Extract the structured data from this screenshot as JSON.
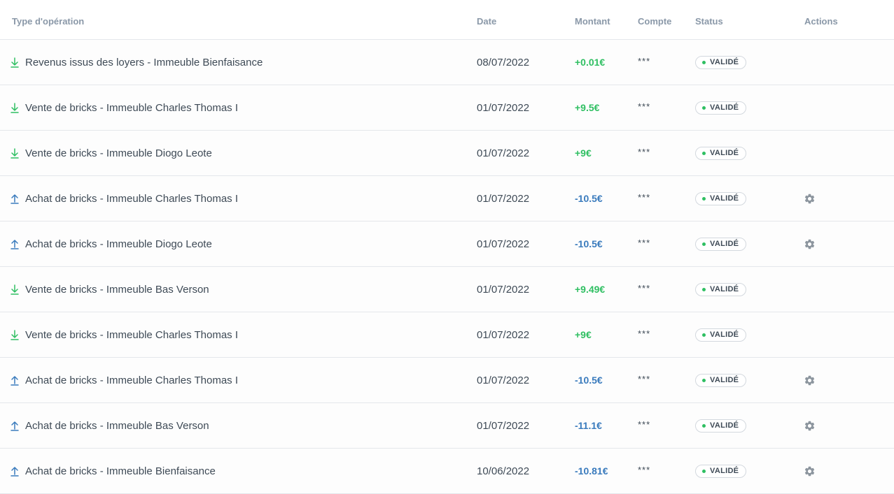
{
  "colors": {
    "positive": "#2fbf62",
    "negative": "#3a7bbd",
    "header_text": "#8a98a8",
    "border": "#e4e7eb"
  },
  "table": {
    "headers": {
      "type": "Type d'opération",
      "date": "Date",
      "amount": "Montant",
      "account": "Compte",
      "status": "Status",
      "actions": "Actions"
    },
    "rows": [
      {
        "direction": "in",
        "icon": "arrow-down-icon",
        "type": "Revenus issus des loyers - Immeuble Bienfaisance",
        "date": "08/07/2022",
        "amount": "+0.01€",
        "account": "***",
        "status": "VALIDÉ",
        "has_action": false
      },
      {
        "direction": "in",
        "icon": "arrow-down-icon",
        "type": "Vente de bricks - Immeuble Charles Thomas I",
        "date": "01/07/2022",
        "amount": "+9.5€",
        "account": "***",
        "status": "VALIDÉ",
        "has_action": false
      },
      {
        "direction": "in",
        "icon": "arrow-down-icon",
        "type": "Vente de bricks - Immeuble Diogo Leote",
        "date": "01/07/2022",
        "amount": "+9€",
        "account": "***",
        "status": "VALIDÉ",
        "has_action": false
      },
      {
        "direction": "out",
        "icon": "arrow-up-icon",
        "type": "Achat de bricks - Immeuble Charles Thomas I",
        "date": "01/07/2022",
        "amount": "-10.5€",
        "account": "***",
        "status": "VALIDÉ",
        "has_action": true,
        "action_icon": "gear-icon"
      },
      {
        "direction": "out",
        "icon": "arrow-up-icon",
        "type": "Achat de bricks - Immeuble Diogo Leote",
        "date": "01/07/2022",
        "amount": "-10.5€",
        "account": "***",
        "status": "VALIDÉ",
        "has_action": true,
        "action_icon": "gear-icon"
      },
      {
        "direction": "in",
        "icon": "arrow-down-icon",
        "type": "Vente de bricks - Immeuble Bas Verson",
        "date": "01/07/2022",
        "amount": "+9.49€",
        "account": "***",
        "status": "VALIDÉ",
        "has_action": false
      },
      {
        "direction": "in",
        "icon": "arrow-down-icon",
        "type": "Vente de bricks - Immeuble Charles Thomas I",
        "date": "01/07/2022",
        "amount": "+9€",
        "account": "***",
        "status": "VALIDÉ",
        "has_action": false
      },
      {
        "direction": "out",
        "icon": "arrow-up-icon",
        "type": "Achat de bricks - Immeuble Charles Thomas I",
        "date": "01/07/2022",
        "amount": "-10.5€",
        "account": "***",
        "status": "VALIDÉ",
        "has_action": true,
        "action_icon": "gear-icon"
      },
      {
        "direction": "out",
        "icon": "arrow-up-icon",
        "type": "Achat de bricks - Immeuble Bas Verson",
        "date": "01/07/2022",
        "amount": "-11.1€",
        "account": "***",
        "status": "VALIDÉ",
        "has_action": true,
        "action_icon": "gear-icon"
      },
      {
        "direction": "out",
        "icon": "arrow-up-icon",
        "type": "Achat de bricks - Immeuble Bienfaisance",
        "date": "10/06/2022",
        "amount": "-10.81€",
        "account": "***",
        "status": "VALIDÉ",
        "has_action": true,
        "action_icon": "gear-icon"
      }
    ]
  }
}
